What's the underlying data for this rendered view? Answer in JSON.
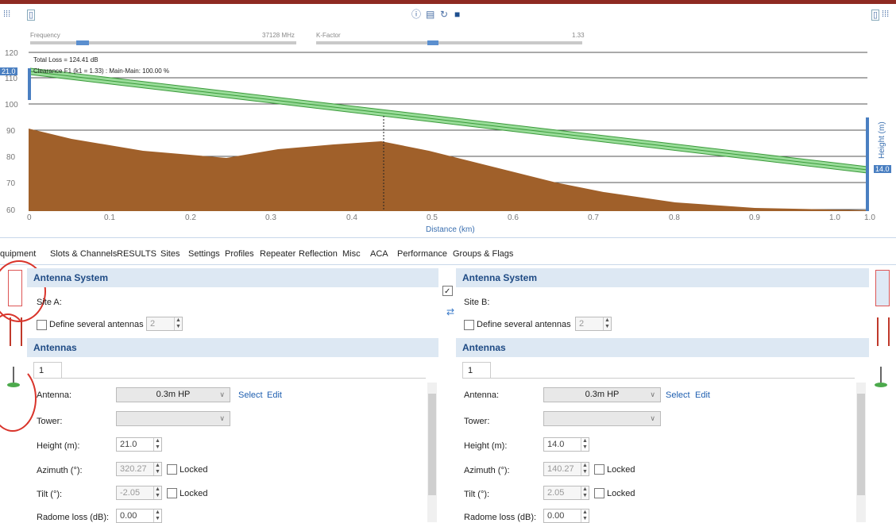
{
  "toolbar": {
    "left_icons": [
      "split-icon",
      "grid-icon"
    ],
    "center_icons": [
      "info-icon",
      "document-icon",
      "rotate-icon",
      "cube-icon"
    ],
    "right_icons": [
      "panel-icon",
      "split-icon"
    ]
  },
  "sliders": {
    "frequency_label": "Frequency",
    "frequency_value": "37128 MHz",
    "kfactor_label": "K-Factor",
    "kfactor_value": "1.33"
  },
  "profile": {
    "total_loss": "Total Loss = 124.41 dB",
    "clearance": "Clearance F1 (k1 = 1.33) :  Main-Main: 100.00 %",
    "left_marker": "21.0",
    "right_marker": "14.0",
    "y_axis_label": "Height (m)",
    "x_axis_label": "Distance (km)",
    "y_ticks": [
      "120",
      "110",
      "100",
      "90",
      "80",
      "70",
      "60"
    ],
    "x_ticks": [
      "0",
      "0.1",
      "0.2",
      "0.3",
      "0.4",
      "0.5",
      "0.6",
      "0.7",
      "0.8",
      "0.9",
      "1.0",
      "1.0"
    ],
    "colors": {
      "terrain": "#a0602a",
      "beam": "#5cc05c",
      "marker": "#4a7fc1"
    }
  },
  "tabs": [
    "quipment",
    "Slots & Channels",
    "RESULTS",
    "Sites",
    "Settings",
    "Profiles",
    "Repeater",
    "Reflection",
    "Misc",
    "ACA",
    "Performance",
    "Groups & Flags"
  ],
  "site_a": {
    "antenna_system_header": "Antenna System",
    "site_label": "Site A:",
    "define_several": "Define several antennas",
    "define_count": "2",
    "antennas_header": "Antennas",
    "tab_label": "1",
    "antenna_label": "Antenna:",
    "antenna_value": "0.3m HP",
    "select_link": "Select",
    "edit_link": "Edit",
    "tower_label": "Tower:",
    "height_label": "Height (m):",
    "height_value": "21.0",
    "azimuth_label": "Azimuth (°):",
    "azimuth_value": "320.27",
    "tilt_label": "Tilt (°):",
    "tilt_value": "-2.05",
    "locked_label": "Locked",
    "radome_label": "Radome loss (dB):",
    "radome_value": "0.00"
  },
  "site_b": {
    "antenna_system_header": "Antenna System",
    "site_label": "Site B:",
    "define_several": "Define several antennas",
    "define_count": "2",
    "antennas_header": "Antennas",
    "tab_label": "1",
    "antenna_label": "Antenna:",
    "antenna_value": "0.3m HP",
    "select_link": "Select",
    "edit_link": "Edit",
    "tower_label": "Tower:",
    "height_label": "Height (m):",
    "height_value": "14.0",
    "azimuth_label": "Azimuth (°):",
    "azimuth_value": "140.27",
    "tilt_label": "Tilt (°):",
    "tilt_value": "2.05",
    "locked_label": "Locked",
    "radome_label": "Radome loss (dB):",
    "radome_value": "0.00"
  }
}
